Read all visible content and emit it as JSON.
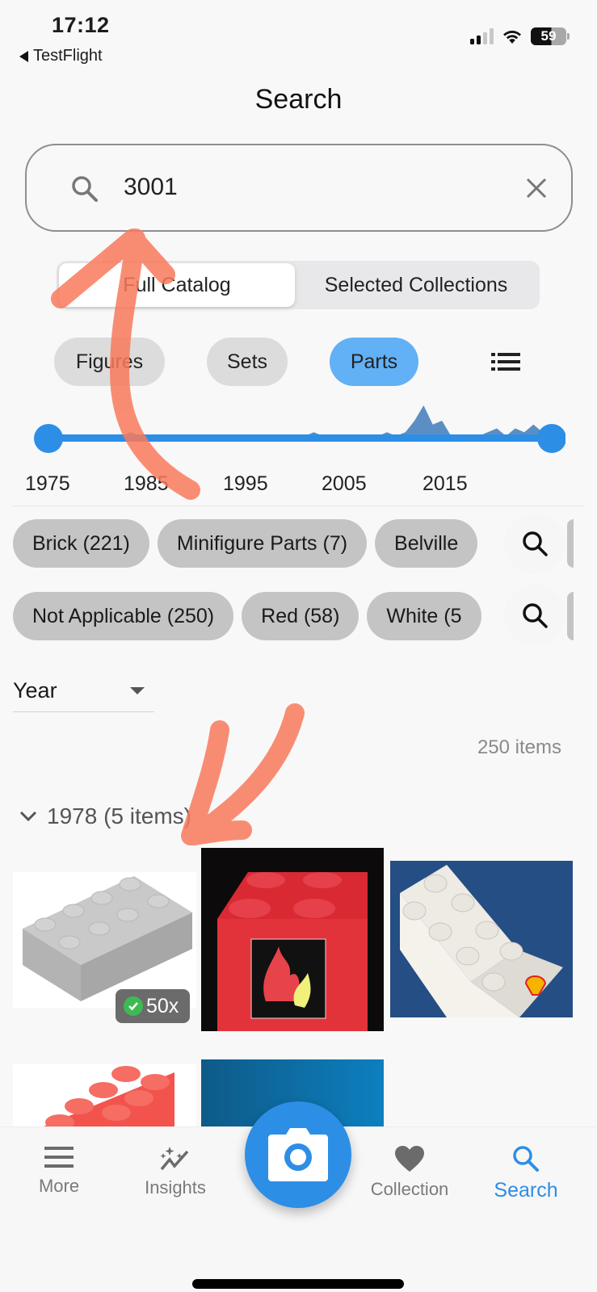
{
  "status_bar": {
    "time": "17:12",
    "back_app": "TestFlight",
    "battery_percent": "59",
    "signal_bars_active": 2,
    "signal_bars_total": 4
  },
  "header": {
    "title": "Search"
  },
  "search": {
    "value": "3001",
    "placeholder": "Search",
    "icon": "search-icon",
    "clear_icon": "close-icon"
  },
  "scope_toggle": {
    "options": [
      "Full Catalog",
      "Selected Collections"
    ],
    "selected": "Full Catalog"
  },
  "type_filters": {
    "options": [
      "Figures",
      "Sets",
      "Parts"
    ],
    "selected": "Parts",
    "view_toggle_icon": "list-icon"
  },
  "year_range": {
    "min_label": "1975",
    "ticks": [
      "1975",
      "1985",
      "1995",
      "2005",
      "2015"
    ],
    "range_start_fraction": 0.0,
    "range_end_fraction": 1.0,
    "histogram": [
      0,
      1,
      0,
      0,
      0,
      0,
      0,
      0,
      0,
      1,
      0,
      0,
      0,
      0,
      0,
      0,
      0,
      0,
      0,
      0,
      0,
      0,
      0,
      0,
      0,
      0,
      0,
      0,
      0,
      1,
      0,
      0,
      0,
      0,
      0,
      0,
      0,
      1,
      0,
      1,
      4,
      8,
      3,
      4,
      0,
      0,
      0,
      0,
      1,
      2,
      0,
      2,
      1,
      3,
      1,
      0
    ]
  },
  "category_chips": [
    "Brick (221)",
    "Minifigure Parts (7)",
    "Belville"
  ],
  "color_chips": [
    "Not Applicable (250)",
    "Red (58)",
    "White (5"
  ],
  "sort": {
    "selected": "Year"
  },
  "results": {
    "count_label": "250 items",
    "groups": [
      {
        "header": "1978 (5 items)",
        "expanded": true,
        "items": [
          {
            "name": "Gray 2x4 brick",
            "owned_badge": "50x"
          },
          {
            "name": "Red 2x4 brick with flame print"
          },
          {
            "name": "White 2x4 brick with Shell logo"
          },
          {
            "name": "Red 2x4 brick"
          },
          {
            "name": "Brick on blue background"
          }
        ]
      }
    ]
  },
  "tab_bar": {
    "items": [
      {
        "label": "More",
        "icon": "menu-icon"
      },
      {
        "label": "Insights",
        "icon": "sparkle-chart-icon"
      },
      {
        "label": "Collection",
        "icon": "heart-icon"
      },
      {
        "label": "Search",
        "icon": "search-icon",
        "active": true
      }
    ],
    "fab_icon": "camera-icon"
  },
  "colors": {
    "accent": "#2d8ee6",
    "active_chip": "#62b0f5",
    "histogram": "#5b8fc4",
    "annotation": "#f97a5c",
    "owned_badge_check": "#3dbb52"
  }
}
